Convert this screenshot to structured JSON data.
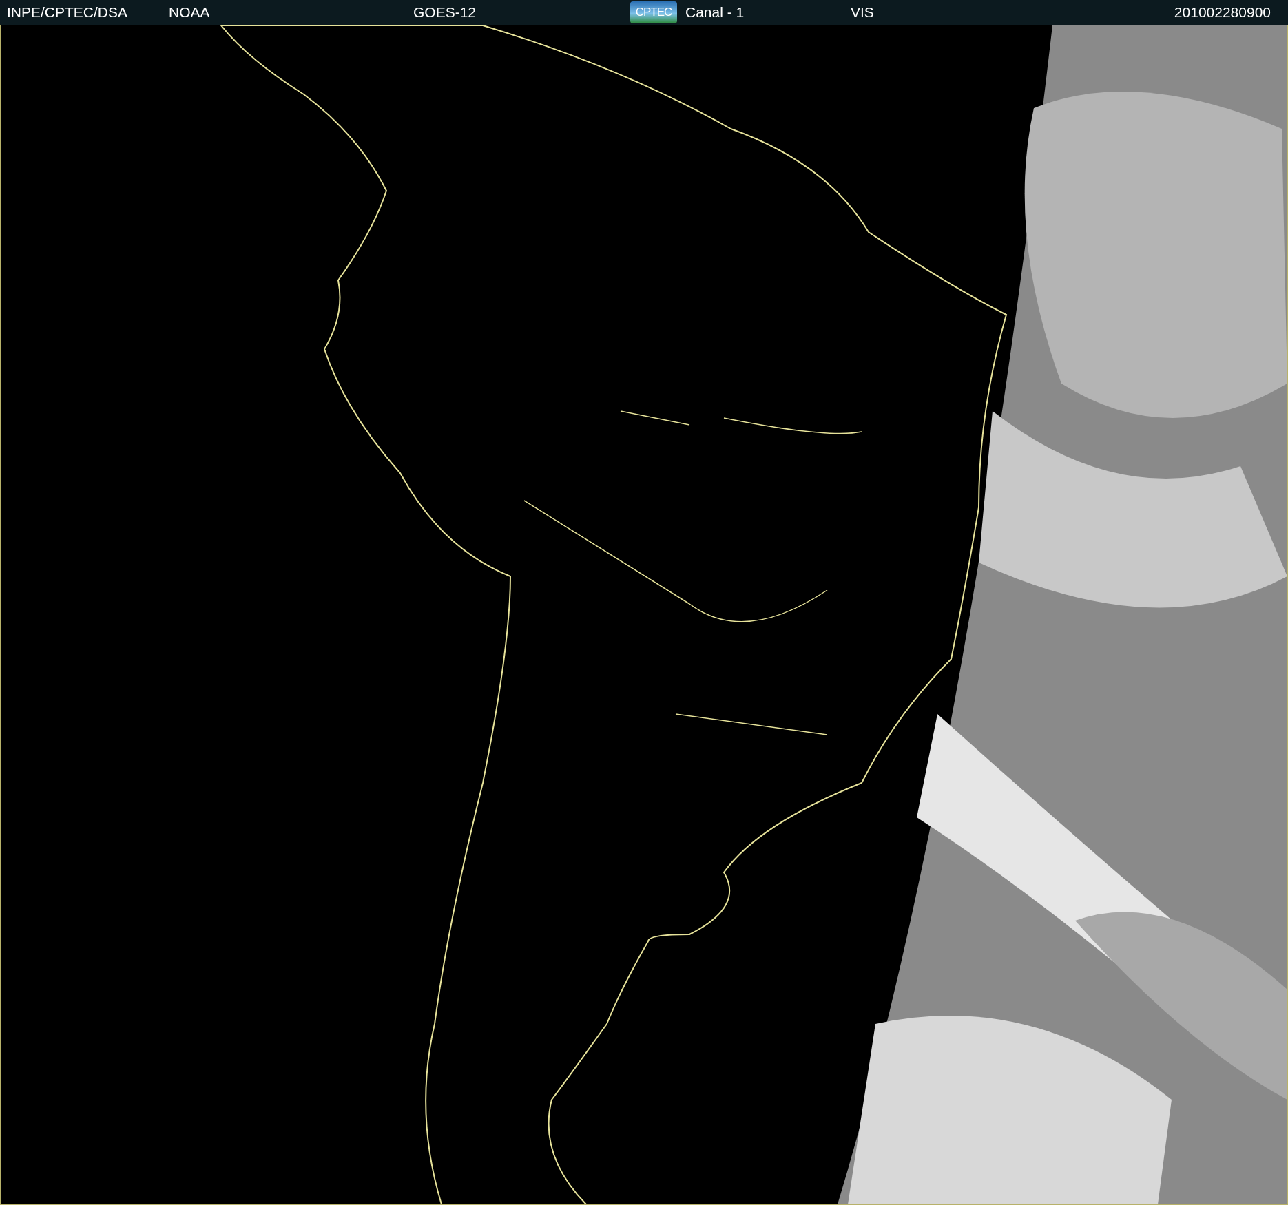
{
  "header": {
    "items": [
      {
        "kind": "text",
        "text": "INPE/CPTEC/DSA"
      },
      {
        "kind": "text",
        "text": "NOAA"
      },
      {
        "kind": "text",
        "text": "GOES-12"
      },
      {
        "kind": "logo",
        "text": "CPTEC"
      },
      {
        "kind": "text",
        "text": "Canal - 1"
      },
      {
        "kind": "text",
        "text": "VIS"
      },
      {
        "kind": "text",
        "text": "201002280900"
      }
    ]
  }
}
